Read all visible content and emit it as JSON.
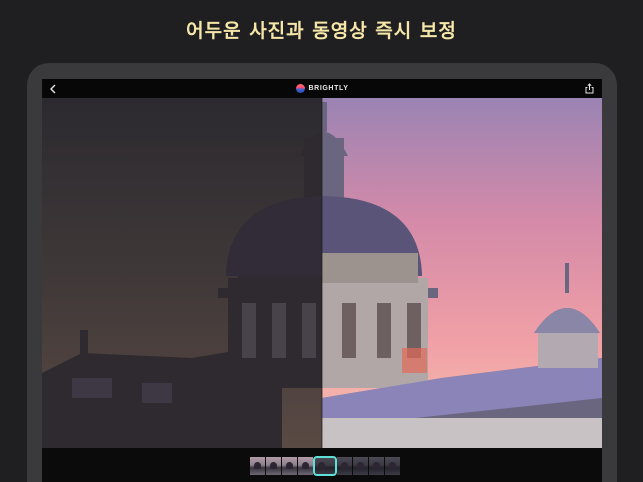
{
  "headline": "어두운 사진과 동영상 즉시 보정",
  "app": {
    "brand_name": "BRIGHTLY",
    "icons": {
      "back": "chevron-left-icon",
      "share": "share-icon",
      "logo": "brightly-logo-icon"
    }
  },
  "colors": {
    "headline": "#f6e6a8",
    "page_background": "#1f1f21",
    "tablet_frame": "#3a3a3c",
    "selection_outline": "#5ee0d8"
  },
  "comparison": {
    "before_side": "left",
    "after_side": "right",
    "split_fraction": 0.5
  },
  "filmstrip": {
    "frame_count": 9,
    "selected_index": 4
  }
}
